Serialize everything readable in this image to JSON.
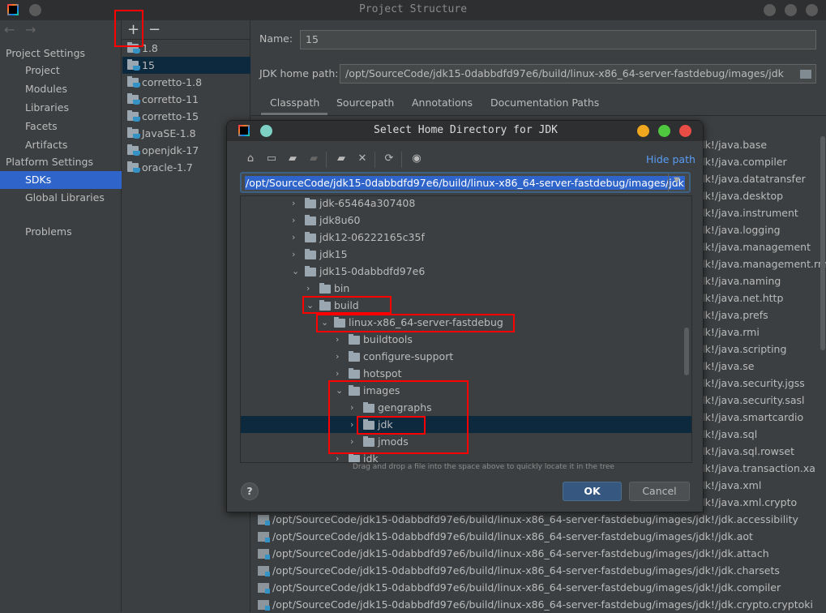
{
  "window": {
    "title": "Project Structure"
  },
  "sidebar": {
    "project_settings": "Project Settings",
    "items_project": [
      "Project",
      "Modules",
      "Libraries",
      "Facets",
      "Artifacts"
    ],
    "platform_settings": "Platform Settings",
    "items_platform": [
      "SDKs",
      "Global Libraries"
    ],
    "problems": "Problems",
    "selected": "SDKs",
    "selected_color": "#2f65ca"
  },
  "sdk_list": {
    "add": "+",
    "remove": "−",
    "items": [
      "1.8",
      "15",
      "corretto-1.8",
      "corretto-11",
      "corretto-15",
      "JavaSE-1.8",
      "openjdk-17",
      "oracle-1.7"
    ],
    "selected": "15"
  },
  "detail": {
    "name_label": "Name:",
    "name_value": "15",
    "home_label": "JDK home path:",
    "home_value": "/opt/SourceCode/jdk15-0dabbdfd97e6/build/linux-x86_64-server-fastdebug/images/jdk",
    "tabs": [
      "Classpath",
      "Sourcepath",
      "Annotations",
      "Documentation Paths"
    ],
    "active_tab": "Classpath",
    "classpath_prefix": "/opt/SourceCode/jdk15-0dabbdfd97e6/build/linux-x86_64-server-fastdebug/images/jdk!/",
    "classpath": [
      "java.base",
      "java.compiler",
      "java.datatransfer",
      "java.desktop",
      "java.instrument",
      "java.logging",
      "java.management",
      "java.management.rmi",
      "java.naming",
      "java.net.http",
      "java.prefs",
      "java.rmi",
      "java.scripting",
      "java.se",
      "java.security.jgss",
      "java.security.sasl",
      "java.smartcardio",
      "java.sql",
      "java.sql.rowset",
      "java.transaction.xa",
      "java.xml",
      "java.xml.crypto",
      "jdk.accessibility",
      "jdk.aot",
      "jdk.attach",
      "jdk.charsets",
      "jdk.compiler",
      "jdk.crypto.cryptoki"
    ]
  },
  "dialog": {
    "title": "Select Home Directory for JDK",
    "hide_path": "Hide path",
    "path": "/opt/SourceCode/jdk15-0dabbdfd97e6/build/linux-x86_64-server-fastdebug/images/jdk",
    "tree": [
      {
        "label": "jdk-65464a307408",
        "level": 0,
        "expanded": false
      },
      {
        "label": "jdk8u60",
        "level": 0,
        "expanded": false
      },
      {
        "label": "jdk12-06222165c35f",
        "level": 0,
        "expanded": false
      },
      {
        "label": "jdk15",
        "level": 0,
        "expanded": false
      },
      {
        "label": "jdk15-0dabbdfd97e6",
        "level": 0,
        "expanded": true
      },
      {
        "label": "bin",
        "level": 1,
        "expanded": false
      },
      {
        "label": "build",
        "level": 1,
        "expanded": true
      },
      {
        "label": "linux-x86_64-server-fastdebug",
        "level": 2,
        "expanded": true
      },
      {
        "label": "buildtools",
        "level": 3,
        "expanded": false
      },
      {
        "label": "configure-support",
        "level": 3,
        "expanded": false
      },
      {
        "label": "hotspot",
        "level": 3,
        "expanded": false
      },
      {
        "label": "images",
        "level": 3,
        "expanded": true
      },
      {
        "label": "gengraphs",
        "level": 4,
        "expanded": false
      },
      {
        "label": "jdk",
        "level": 4,
        "expanded": false,
        "selected": true
      },
      {
        "label": "jmods",
        "level": 4,
        "expanded": false
      },
      {
        "label": "jdk",
        "level": 3,
        "expanded": false
      }
    ],
    "hint": "Drag and drop a file into the space above to quickly locate it in the tree",
    "help": "?",
    "ok": "OK",
    "cancel": "Cancel",
    "traffic_colors": [
      "#f0a61f",
      "#4fc83f",
      "#ea4d45"
    ]
  }
}
